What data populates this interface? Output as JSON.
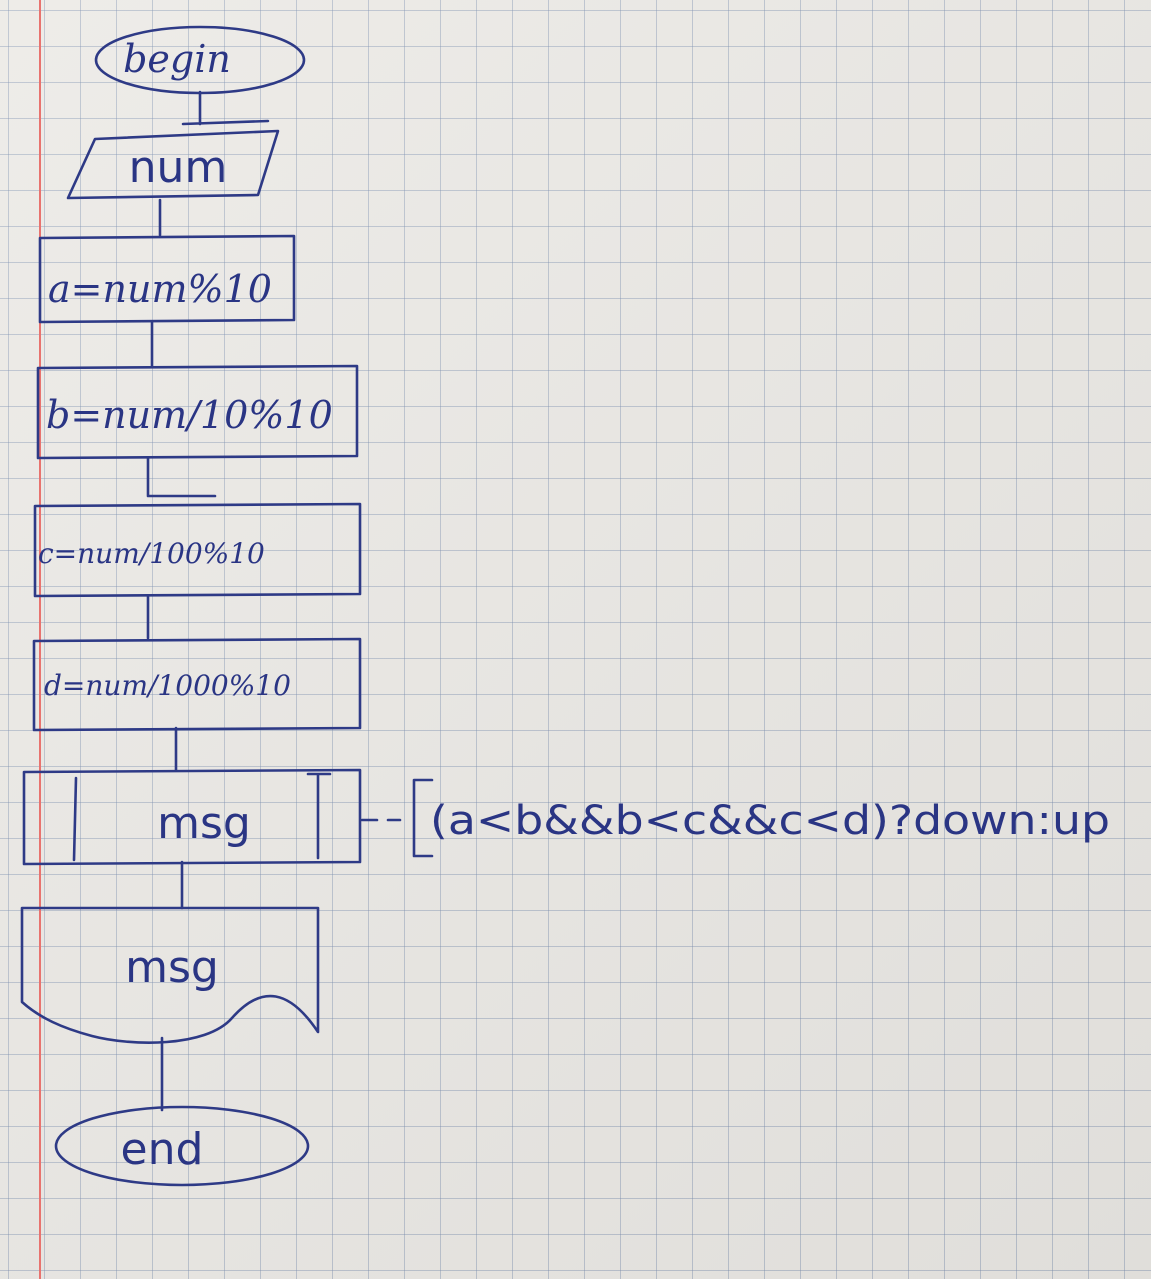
{
  "flowchart": {
    "start": "begin",
    "input": "num",
    "step_a": "a=num%10",
    "step_b": "b=num/10%10",
    "step_c": "c=num/100%10",
    "step_d": "d=num/1000%10",
    "process_msg": "msg",
    "output_msg": "msg",
    "annotation": "(a<b&&b<c&&c<d)?down:up",
    "end": "end"
  },
  "colors": {
    "ink": "#2e3a86",
    "margin": "#e8736f",
    "grid": "#7d8caf"
  }
}
